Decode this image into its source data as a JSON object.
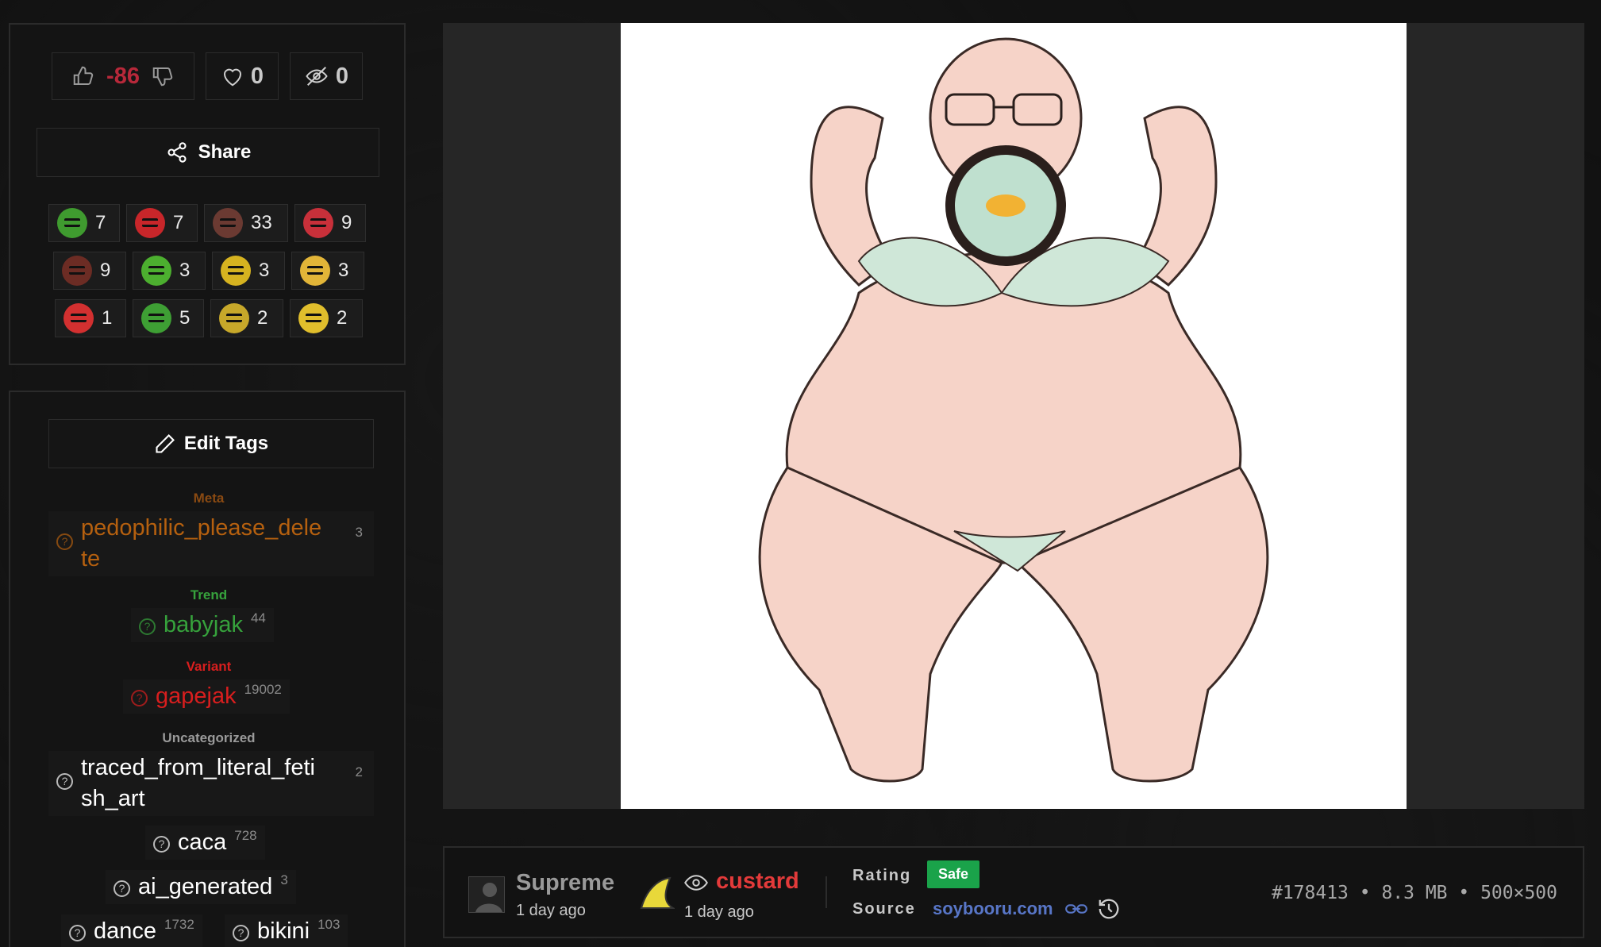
{
  "votes": {
    "score": "-86",
    "favorites": "0",
    "hidden": "0"
  },
  "share_label": "Share",
  "reactions": [
    {
      "count": "7",
      "icon": "pepe-smug-icon",
      "color": "#3f9b2f"
    },
    {
      "count": "7",
      "icon": "angry-red-jak-icon",
      "color": "#c8262a"
    },
    {
      "count": "33",
      "icon": "dark-jak-icon",
      "color": "#6b3a32"
    },
    {
      "count": "9",
      "icon": "red-jak-icon",
      "color": "#c8303a"
    },
    {
      "count": "9",
      "icon": "black-jak-icon",
      "color": "#6c2c24"
    },
    {
      "count": "3",
      "icon": "green-jak-icon",
      "color": "#4caf2f"
    },
    {
      "count": "3",
      "icon": "yellow-jak-icon",
      "color": "#d6b320"
    },
    {
      "count": "3",
      "icon": "heart-jak-icon",
      "color": "#e2b538"
    },
    {
      "count": "1",
      "icon": "no-entry-icon",
      "color": "#d33030"
    },
    {
      "count": "5",
      "icon": "pepe-icon",
      "color": "#3e9f34"
    },
    {
      "count": "2",
      "icon": "crying-jak-icon",
      "color": "#c7a82a"
    },
    {
      "count": "2",
      "icon": "gape-jak-icon",
      "color": "#e0be2c"
    }
  ],
  "edit_tags_label": "Edit Tags",
  "tag_groups": {
    "meta": {
      "label": "Meta",
      "tags": [
        {
          "name": "pedophilic_please_delete",
          "line1": "pedophilic_please_dele",
          "line2": "te",
          "count": "3"
        }
      ]
    },
    "trend": {
      "label": "Trend",
      "tags": [
        {
          "name": "babyjak",
          "count": "44"
        }
      ]
    },
    "variant": {
      "label": "Variant",
      "tags": [
        {
          "name": "gapejak",
          "count": "19002"
        }
      ]
    },
    "uncategorized": {
      "label": "Uncategorized",
      "tags": [
        {
          "name": "traced_from_literal_fetish_art",
          "line1": "traced_from_literal_feti",
          "line2": "sh_art",
          "count": "2"
        },
        {
          "name": "caca",
          "count": "728"
        },
        {
          "name": "ai_generated",
          "count": "3"
        },
        {
          "name": "dance",
          "count": "1732"
        },
        {
          "name": "bikini",
          "count": "103"
        }
      ]
    }
  },
  "colors": {
    "meta": "#b5600f",
    "trend": "#36a23c",
    "variant": "#d81e1e",
    "uncategorized": "#ffffff",
    "safe": "#1aa34a",
    "link": "#5876c7"
  },
  "uploader": {
    "name": "Supreme",
    "time": "1 day ago"
  },
  "approver": {
    "name": "custard",
    "time": "1 day ago"
  },
  "rating": {
    "label": "Rating",
    "value": "Safe"
  },
  "source": {
    "label": "Source",
    "value": "soybooru.com"
  },
  "post_meta": "#178413 • 8.3 MB • 500×500"
}
